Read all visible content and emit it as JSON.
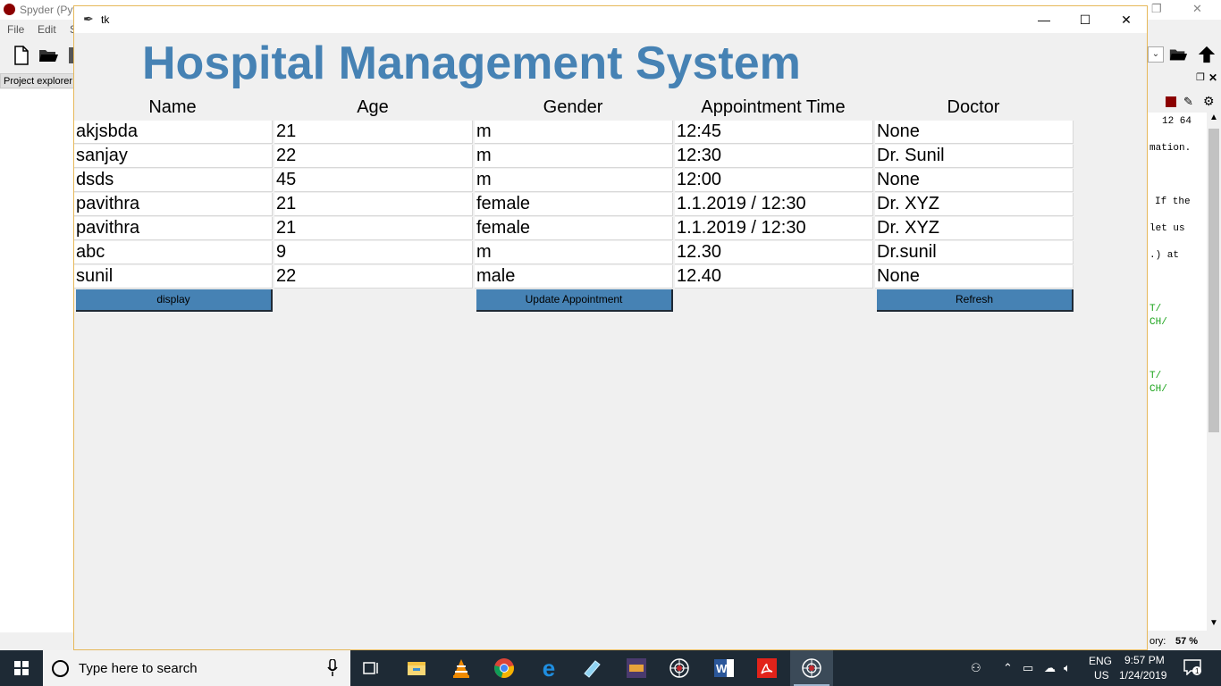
{
  "spyder": {
    "title": "Spyder (Pyt",
    "menu": [
      "File",
      "Edit",
      "S"
    ],
    "project_explorer_tab": "Project explorer",
    "console_lines": [
      "12 64",
      "mation.",
      "If the",
      "let us",
      ".) at"
    ],
    "console_green_lines": [
      "T/",
      "CH/",
      "T/",
      "CH/"
    ],
    "status_label": "ory:",
    "status_value": "57 %"
  },
  "tk": {
    "title": "tk",
    "heading": "Hospital Management System",
    "columns": [
      "Name",
      "Age",
      "Gender",
      "Appointment Time",
      "Doctor"
    ],
    "rows": [
      [
        "akjsbda",
        "21",
        "m",
        "12:45",
        "None"
      ],
      [
        "sanjay",
        "22",
        "m",
        "12:30",
        "Dr. Sunil"
      ],
      [
        "dsds",
        "45",
        "m",
        "12:00",
        "None"
      ],
      [
        "pavithra",
        "21",
        "female",
        "1.1.2019 / 12:30",
        "Dr. XYZ"
      ],
      [
        "pavithra",
        "21",
        "female",
        "1.1.2019 / 12:30",
        "Dr. XYZ"
      ],
      [
        "abc",
        "9",
        "m",
        "12.30",
        "Dr.sunil"
      ],
      [
        "sunil",
        "22",
        "male",
        "12.40",
        "None"
      ]
    ],
    "buttons": {
      "display": "display",
      "update": "Update Appointment",
      "refresh": "Refresh"
    },
    "colors": {
      "heading": "#4682b4",
      "button": "#4682b4"
    }
  },
  "taskbar": {
    "search_placeholder": "Type here to search",
    "apps": [
      "task-view",
      "file-explorer",
      "vlc",
      "chrome",
      "edge",
      "notepad",
      "ide",
      "spyder-alt",
      "word",
      "acrobat",
      "spyder"
    ],
    "lang_top": "ENG",
    "lang_bottom": "US",
    "time": "9:57 PM",
    "date": "1/24/2019",
    "notification_count": "1"
  }
}
